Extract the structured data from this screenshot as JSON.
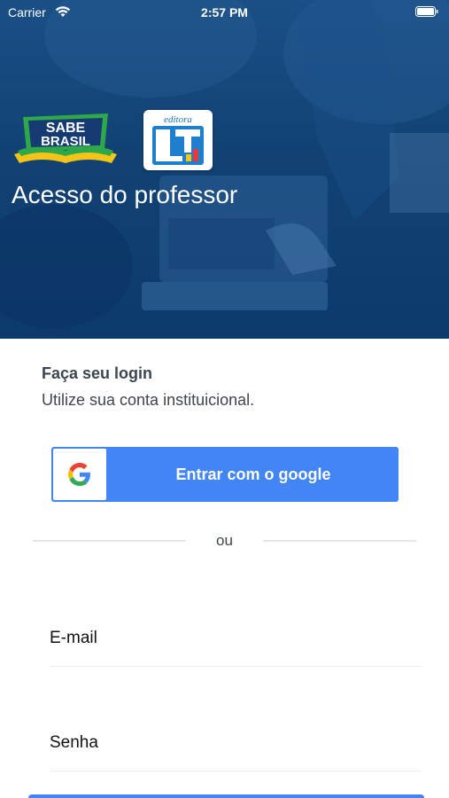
{
  "status_bar": {
    "carrier": "Carrier",
    "time": "2:57 PM"
  },
  "hero": {
    "title": "Acesso do professor",
    "logo_sabe_brasil": "SABE BRASIL",
    "logo_editora": "editora LT"
  },
  "login": {
    "title": "Faça seu login",
    "subtitle": "Utilize sua conta instituicional."
  },
  "google_button": {
    "label": "Entrar com o google",
    "icon": "google-g-icon"
  },
  "divider": {
    "label": "ou"
  },
  "form": {
    "email_placeholder": "E-mail",
    "password_placeholder": "Senha"
  },
  "colors": {
    "hero_overlay": "#124274",
    "google_blue": "#4285f4",
    "text_dark": "#3d4650",
    "sabe_green": "#2ea84a",
    "sabe_yellow": "#f5c419",
    "sabe_navy": "#163a72"
  }
}
